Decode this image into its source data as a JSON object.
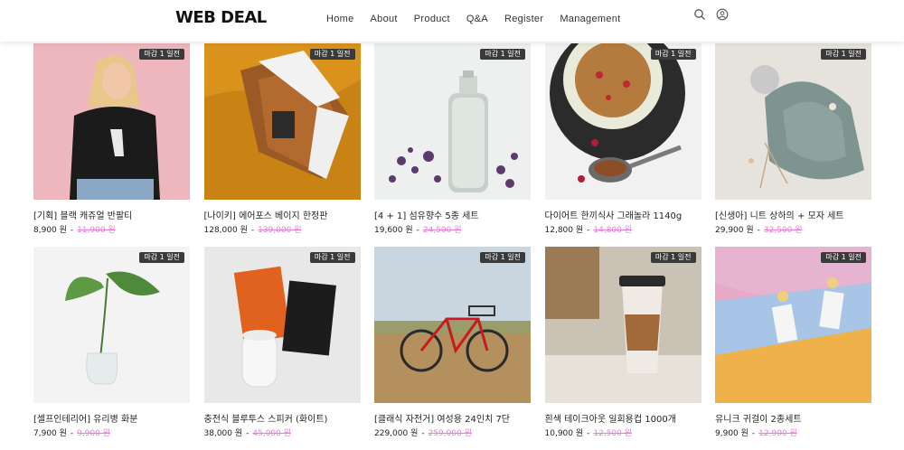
{
  "header": {
    "logo": "WEB DEAL",
    "nav": [
      "Home",
      "About",
      "Product",
      "Q&A",
      "Register",
      "Management"
    ],
    "icons": [
      "search-icon",
      "user-icon"
    ]
  },
  "products": [
    {
      "badge": "마감 1 일전",
      "title": "[기획] 블랙 캐쥬얼 반팔티",
      "price": "8,900 원",
      "orig": "11,900 원",
      "image": "woman-tshirt-photo"
    },
    {
      "badge": "마감 1 일전",
      "title": "[나이키] 에어포스 베이지 한정판",
      "price": "128,000 원",
      "orig": "139,000 원",
      "image": "sneaker-photo"
    },
    {
      "badge": "마감 1 일전",
      "title": "[4 + 1] 섬유향수 5종 세트",
      "price": "19,600 원",
      "orig": "24,500 원",
      "image": "perfume-bottle-photo"
    },
    {
      "badge": "마감 1 일전",
      "title": "다이어트 한끼식사 그래놀라 1140g",
      "price": "12,800 원",
      "orig": "14,800 원",
      "image": "granola-bowl-photo"
    },
    {
      "badge": "마감 1 일전",
      "title": "[신생아] 니트 상하의 + 모자 세트",
      "price": "29,900 원",
      "orig": "32,500 원",
      "image": "knit-baby-set-photo"
    },
    {
      "badge": "마감 1 일전",
      "title": "[셀프인테리어] 유리병 화분",
      "price": "7,900 원",
      "orig": "9,900 원",
      "image": "glass-vase-plant-photo"
    },
    {
      "badge": "마감 1 일전",
      "title": "충전식 블루투스 스피커 (화이트)",
      "price": "38,000 원",
      "orig": "45,000 원",
      "image": "speaker-books-photo"
    },
    {
      "badge": "마감 1 일전",
      "title": "[클래식 자전거] 여성용 24인치 7단",
      "price": "229,000 원",
      "orig": "259,000 원",
      "image": "red-bicycle-photo"
    },
    {
      "badge": "마감 1 일전",
      "title": "흰색 테이크아웃 일회용컵 1000개",
      "price": "10,900 원",
      "orig": "12,500 원",
      "image": "coffee-cup-photo"
    },
    {
      "badge": "마감 1 일전",
      "title": "유니크 귀걸이 2종세트",
      "price": "9,900 원",
      "orig": "12,900 원",
      "image": "earrings-photo"
    }
  ]
}
